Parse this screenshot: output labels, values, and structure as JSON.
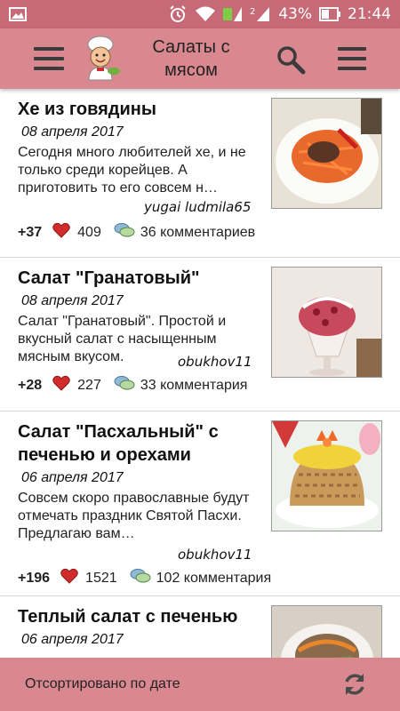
{
  "status_bar": {
    "battery_percent": "43%",
    "time": "21:44",
    "sim_slot": "2"
  },
  "app_bar": {
    "title_line1": "Салаты с",
    "title_line2": "мясом",
    "icons": [
      "menu-icon",
      "chef-logo",
      "search-icon",
      "more-menu-icon"
    ]
  },
  "articles": [
    {
      "title": "Хе из говядины",
      "date": "08 апреля 2017",
      "description": "Сегодня много любителей хе, и не только среди корейцев. А приготовить то его совсем н…",
      "author": "yugai ludmila65",
      "score": "+37",
      "likes": "409",
      "comments": "36 комментариев"
    },
    {
      "title": "Салат \"Гранатовый\"",
      "date": "08 апреля 2017",
      "description": "Салат \"Гранатовый\". Простой и вкусный салат с насыщенным мясным вкусом.",
      "author": "obukhov11",
      "score": "+28",
      "likes": "227",
      "comments": "33 комментария"
    },
    {
      "title": "Салат \"Пасхальный\" с печенью и орехами",
      "date": "06 апреля 2017",
      "description": "Совсем скоро православные будут отмечать праздник Святой Пасхи. Предлагаю вам…",
      "author": "obukhov11",
      "score": "+196",
      "likes": "1521",
      "comments": "102 комментария"
    },
    {
      "title": "Теплый салат с печенью",
      "date": "06 апреля 2017",
      "description": "",
      "author": "",
      "score": "",
      "likes": "",
      "comments": ""
    }
  ],
  "bottom_bar": {
    "sort_label": "Отсортировано по дате",
    "refresh_icon": "refresh-icon"
  },
  "colors": {
    "status_bar": "#c76a77",
    "app_bar": "#d9888f",
    "heart": "#d22b2b"
  }
}
